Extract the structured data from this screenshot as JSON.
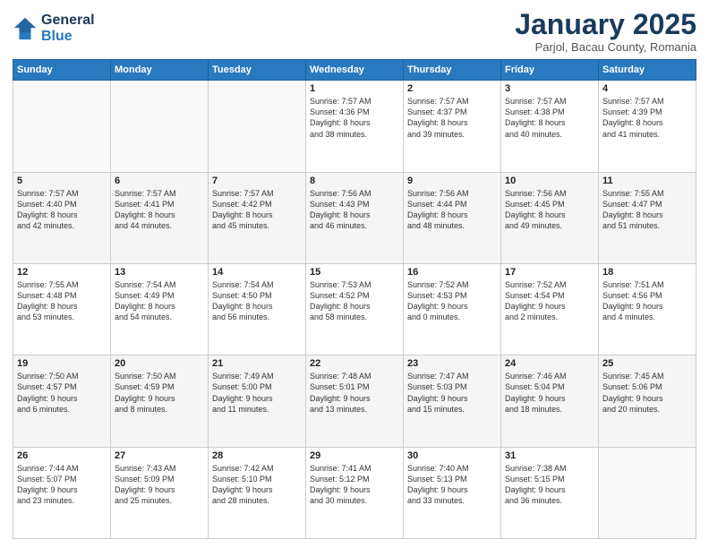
{
  "logo": {
    "general": "General",
    "blue": "Blue"
  },
  "title": "January 2025",
  "subtitle": "Parjol, Bacau County, Romania",
  "days": [
    "Sunday",
    "Monday",
    "Tuesday",
    "Wednesday",
    "Thursday",
    "Friday",
    "Saturday"
  ],
  "weeks": [
    [
      {
        "date": "",
        "info": ""
      },
      {
        "date": "",
        "info": ""
      },
      {
        "date": "",
        "info": ""
      },
      {
        "date": "1",
        "info": "Sunrise: 7:57 AM\nSunset: 4:36 PM\nDaylight: 8 hours\nand 38 minutes."
      },
      {
        "date": "2",
        "info": "Sunrise: 7:57 AM\nSunset: 4:37 PM\nDaylight: 8 hours\nand 39 minutes."
      },
      {
        "date": "3",
        "info": "Sunrise: 7:57 AM\nSunset: 4:38 PM\nDaylight: 8 hours\nand 40 minutes."
      },
      {
        "date": "4",
        "info": "Sunrise: 7:57 AM\nSunset: 4:39 PM\nDaylight: 8 hours\nand 41 minutes."
      }
    ],
    [
      {
        "date": "5",
        "info": "Sunrise: 7:57 AM\nSunset: 4:40 PM\nDaylight: 8 hours\nand 42 minutes."
      },
      {
        "date": "6",
        "info": "Sunrise: 7:57 AM\nSunset: 4:41 PM\nDaylight: 8 hours\nand 44 minutes."
      },
      {
        "date": "7",
        "info": "Sunrise: 7:57 AM\nSunset: 4:42 PM\nDaylight: 8 hours\nand 45 minutes."
      },
      {
        "date": "8",
        "info": "Sunrise: 7:56 AM\nSunset: 4:43 PM\nDaylight: 8 hours\nand 46 minutes."
      },
      {
        "date": "9",
        "info": "Sunrise: 7:56 AM\nSunset: 4:44 PM\nDaylight: 8 hours\nand 48 minutes."
      },
      {
        "date": "10",
        "info": "Sunrise: 7:56 AM\nSunset: 4:45 PM\nDaylight: 8 hours\nand 49 minutes."
      },
      {
        "date": "11",
        "info": "Sunrise: 7:55 AM\nSunset: 4:47 PM\nDaylight: 8 hours\nand 51 minutes."
      }
    ],
    [
      {
        "date": "12",
        "info": "Sunrise: 7:55 AM\nSunset: 4:48 PM\nDaylight: 8 hours\nand 53 minutes."
      },
      {
        "date": "13",
        "info": "Sunrise: 7:54 AM\nSunset: 4:49 PM\nDaylight: 8 hours\nand 54 minutes."
      },
      {
        "date": "14",
        "info": "Sunrise: 7:54 AM\nSunset: 4:50 PM\nDaylight: 8 hours\nand 56 minutes."
      },
      {
        "date": "15",
        "info": "Sunrise: 7:53 AM\nSunset: 4:52 PM\nDaylight: 8 hours\nand 58 minutes."
      },
      {
        "date": "16",
        "info": "Sunrise: 7:52 AM\nSunset: 4:53 PM\nDaylight: 9 hours\nand 0 minutes."
      },
      {
        "date": "17",
        "info": "Sunrise: 7:52 AM\nSunset: 4:54 PM\nDaylight: 9 hours\nand 2 minutes."
      },
      {
        "date": "18",
        "info": "Sunrise: 7:51 AM\nSunset: 4:56 PM\nDaylight: 9 hours\nand 4 minutes."
      }
    ],
    [
      {
        "date": "19",
        "info": "Sunrise: 7:50 AM\nSunset: 4:57 PM\nDaylight: 9 hours\nand 6 minutes."
      },
      {
        "date": "20",
        "info": "Sunrise: 7:50 AM\nSunset: 4:59 PM\nDaylight: 9 hours\nand 8 minutes."
      },
      {
        "date": "21",
        "info": "Sunrise: 7:49 AM\nSunset: 5:00 PM\nDaylight: 9 hours\nand 11 minutes."
      },
      {
        "date": "22",
        "info": "Sunrise: 7:48 AM\nSunset: 5:01 PM\nDaylight: 9 hours\nand 13 minutes."
      },
      {
        "date": "23",
        "info": "Sunrise: 7:47 AM\nSunset: 5:03 PM\nDaylight: 9 hours\nand 15 minutes."
      },
      {
        "date": "24",
        "info": "Sunrise: 7:46 AM\nSunset: 5:04 PM\nDaylight: 9 hours\nand 18 minutes."
      },
      {
        "date": "25",
        "info": "Sunrise: 7:45 AM\nSunset: 5:06 PM\nDaylight: 9 hours\nand 20 minutes."
      }
    ],
    [
      {
        "date": "26",
        "info": "Sunrise: 7:44 AM\nSunset: 5:07 PM\nDaylight: 9 hours\nand 23 minutes."
      },
      {
        "date": "27",
        "info": "Sunrise: 7:43 AM\nSunset: 5:09 PM\nDaylight: 9 hours\nand 25 minutes."
      },
      {
        "date": "28",
        "info": "Sunrise: 7:42 AM\nSunset: 5:10 PM\nDaylight: 9 hours\nand 28 minutes."
      },
      {
        "date": "29",
        "info": "Sunrise: 7:41 AM\nSunset: 5:12 PM\nDaylight: 9 hours\nand 30 minutes."
      },
      {
        "date": "30",
        "info": "Sunrise: 7:40 AM\nSunset: 5:13 PM\nDaylight: 9 hours\nand 33 minutes."
      },
      {
        "date": "31",
        "info": "Sunrise: 7:38 AM\nSunset: 5:15 PM\nDaylight: 9 hours\nand 36 minutes."
      },
      {
        "date": "",
        "info": ""
      }
    ]
  ]
}
